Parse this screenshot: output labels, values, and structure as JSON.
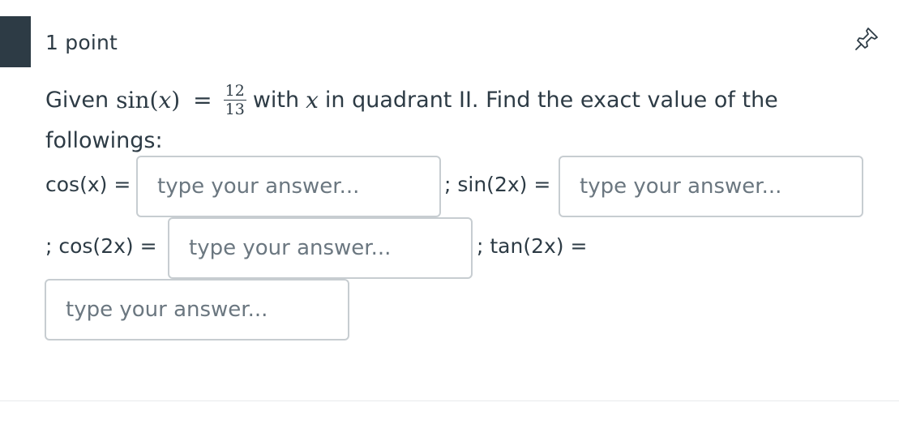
{
  "question": {
    "points_label": "1 point",
    "intro_word": "Given",
    "sin_func": "sin",
    "open_paren": "(",
    "var_x": "x",
    "close_paren": ")",
    "equals": "=",
    "fraction_numerator": "12",
    "fraction_denominator": "13",
    "with_word": "with",
    "var_x_second": "x",
    "rest_line1": "in quadrant II. Find the exact value of the",
    "line2": "followings:"
  },
  "pin_icon": "pushpin-icon",
  "answers": {
    "cos_x_label": "cos(x) =",
    "sin_2x_label": "; sin(2x) =",
    "cos_2x_label": "; cos(2x) =",
    "tan_2x_label": "; tan(2x) =",
    "placeholder": "type your answer...",
    "cos_x_value": "",
    "sin_2x_value": "",
    "cos_2x_value": "",
    "tan_2x_value": ""
  },
  "colors": {
    "accent_bar": "#2d3b45",
    "text": "#2d3b45",
    "input_border": "#c7cdd1",
    "placeholder": "#6b7780"
  }
}
